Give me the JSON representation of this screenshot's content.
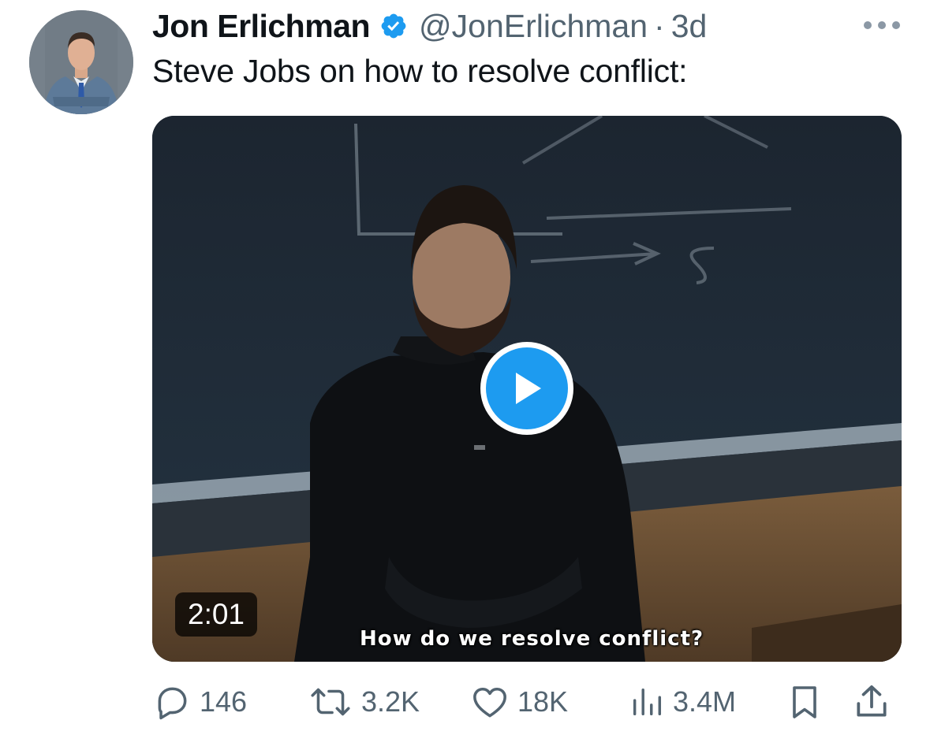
{
  "tweet": {
    "author_name": "Jon Erlichman",
    "handle": "@JonErlichman",
    "separator": "·",
    "time": "3d",
    "text": "Steve Jobs on how to resolve conflict:",
    "verified_icon": "verified-badge-icon",
    "more_icon": "more-horizontal-icon"
  },
  "media": {
    "duration": "2:01",
    "subtitle": "How do we resolve conflict?",
    "play_icon": "play-icon"
  },
  "actions": {
    "replies": "146",
    "retweets": "3.2K",
    "likes": "18K",
    "views": "3.4M",
    "icons": [
      "reply-icon",
      "retweet-icon",
      "like-icon",
      "views-icon",
      "bookmark-icon",
      "share-icon"
    ]
  },
  "colors": {
    "accent": "#1d9bf0",
    "text": "#0f1419",
    "secondary": "#536471"
  }
}
